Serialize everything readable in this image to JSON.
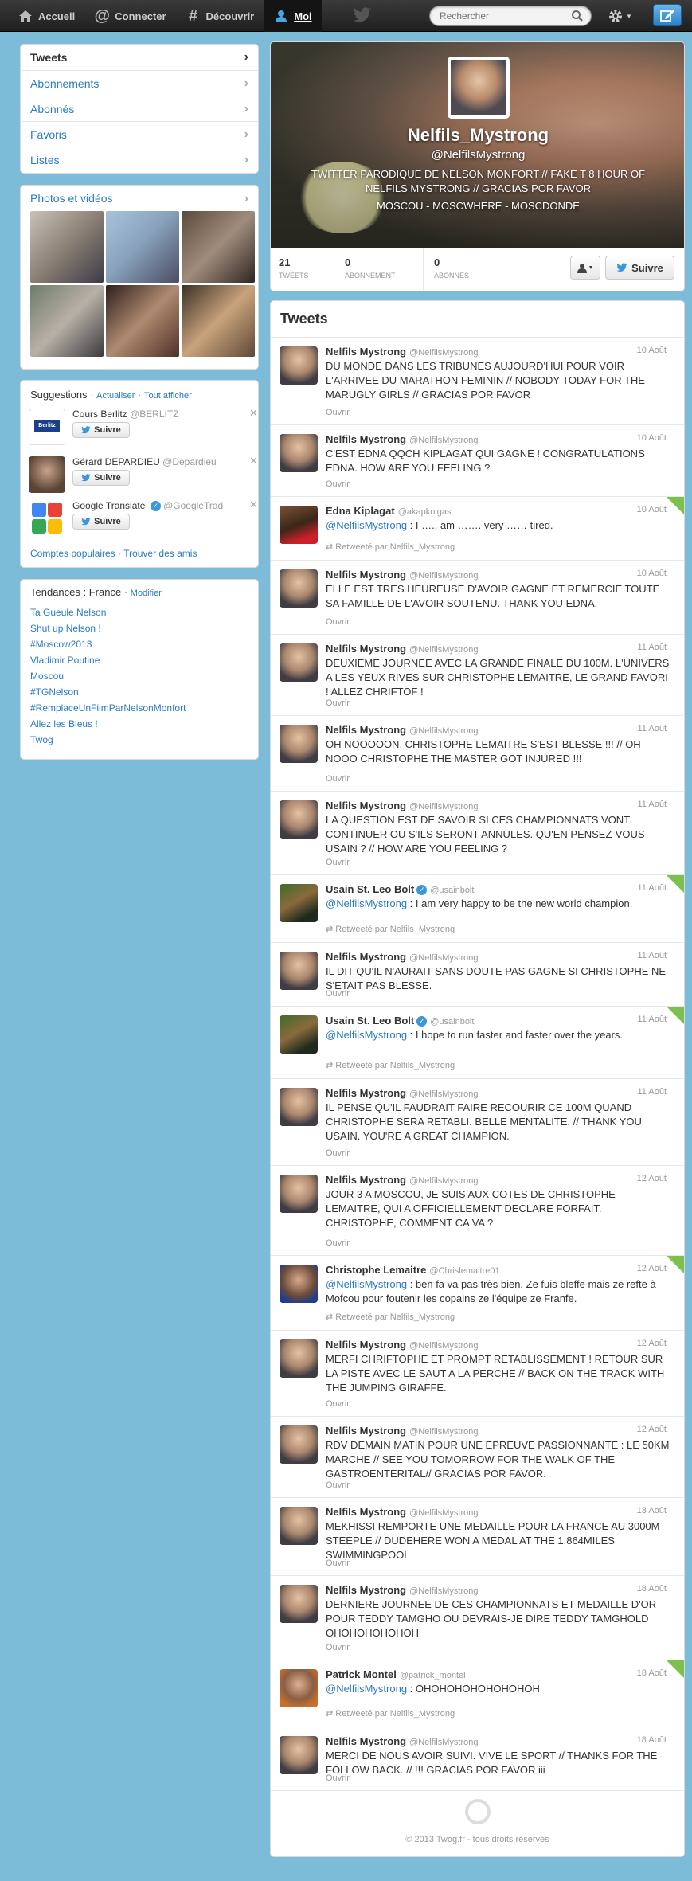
{
  "nav": {
    "items": [
      {
        "label": "Accueil",
        "icon": "home-icon"
      },
      {
        "label": "Connecter",
        "icon": "at-icon"
      },
      {
        "label": "Découvrir",
        "icon": "hash-icon"
      },
      {
        "label": "Moi",
        "icon": "person-icon"
      }
    ]
  },
  "search": {
    "placeholder": "Rechercher"
  },
  "sidebar": {
    "menu": [
      "Tweets",
      "Abonnements",
      "Abonnés",
      "Favoris",
      "Listes"
    ],
    "photos_title": "Photos et vidéos",
    "suggestions": {
      "title": "Suggestions",
      "refresh": "Actualiser",
      "show_all": "Tout afficher",
      "items": [
        {
          "name": "Cours Berlitz",
          "handle": "@BERLITZ",
          "button": "Suivre"
        },
        {
          "name": "Gérard DEPARDIEU",
          "handle": "@Depardieu",
          "button": "Suivre"
        },
        {
          "name": "Google Translate",
          "handle": "@GoogleTrad",
          "button": "Suivre"
        }
      ],
      "popular": "Comptes populaires",
      "find_friends": "Trouver des amis",
      "separator": "·"
    },
    "trends": {
      "title": "Tendances : France",
      "modify": "Modifier",
      "items": [
        "Ta Gueule Nelson",
        "Shut up Nelson !",
        "#Moscow2013",
        "Vladimir Poutine",
        "Moscou",
        "#TGNelson",
        "#RemplaceUnFilmParNelsonMonfort",
        "Allez les Bleus !",
        "Twog"
      ]
    }
  },
  "profile": {
    "name": "Nelfils_Mystrong",
    "handle": "@NelfilsMystrong",
    "bio": "TWITTER PARODIQUE DE NELSON MONFORT // FAKE T 8 HOUR OF NELFILS MYSTRONG // GRACIAS POR FAVOR",
    "location": "MOSCOU - MOSCWHERE - MOSCDONDE",
    "stats": [
      {
        "value": "21",
        "label": "TWEETS"
      },
      {
        "value": "0",
        "label": "ABONNEMENT"
      },
      {
        "value": "0",
        "label": "ABONNÉS"
      }
    ],
    "follow_button": "Suivre"
  },
  "timeline": {
    "title": "Tweets",
    "open_label": "Ouvrir",
    "tweets": [
      {
        "name": "Nelfils Mystrong",
        "handle": "@NelfilsMystrong",
        "date": "10 Août",
        "mention": "",
        "text": "DU MONDE DANS LES TRIBUNES AUJOURD'HUI POUR VOIR L'ARRIVEE DU MARATHON FEMININ // NOBODY TODAY FOR THE MARUGLY GIRLS // GRACIAS POR FAVOR",
        "retweet": ""
      },
      {
        "name": "Nelfils Mystrong",
        "handle": "@NelfilsMystrong",
        "date": "10 Août",
        "mention": "",
        "text": "C'EST EDNA QQCH KIPLAGAT QUI GAGNE ! CONGRATULATIONS EDNA. HOW ARE YOU FEELING ?",
        "retweet": ""
      },
      {
        "name": "Edna Kiplagat",
        "handle": "@akapkoigas",
        "date": "10 Août",
        "mention": "@NelfilsMystrong",
        "text": " : I ….. am ……. very …… tired.",
        "retweet": "Retweeté par Nelfils_Mystrong"
      },
      {
        "name": "Nelfils Mystrong",
        "handle": "@NelfilsMystrong",
        "date": "10 Août",
        "mention": "",
        "text": "ELLE EST TRES HEUREUSE D'AVOIR GAGNE ET REMERCIE TOUTE SA FAMILLE DE L'AVOIR SOUTENU. THANK YOU EDNA.",
        "retweet": ""
      },
      {
        "name": "Nelfils Mystrong",
        "handle": "@NelfilsMystrong",
        "date": "11 Août",
        "mention": "",
        "text": "DEUXIEME JOURNEE AVEC LA GRANDE FINALE DU 100M. L'UNIVERS A LES YEUX RIVES SUR CHRISTOPHE LEMAITRE, LE GRAND FAVORI ! ALLEZ CHRIFTOF !",
        "retweet": ""
      },
      {
        "name": "Nelfils Mystrong",
        "handle": "@NelfilsMystrong",
        "date": "11 Août",
        "mention": "",
        "text": "OH NOOOOON, CHRISTOPHE LEMAITRE S'EST BLESSE !!! // OH NOOO CHRISTOPHE THE MASTER GOT INJURED !!!",
        "retweet": ""
      },
      {
        "name": "Nelfils Mystrong",
        "handle": "@NelfilsMystrong",
        "date": "11 Août",
        "mention": "",
        "text": "LA QUESTION EST DE SAVOIR SI CES CHAMPIONNATS VONT CONTINUER OU S'ILS SERONT ANNULES. QU'EN PENSEZ-VOUS USAIN ? // HOW ARE YOU FEELING ?",
        "retweet": ""
      },
      {
        "name": "Usain St. Leo Bolt",
        "handle": "@usainbolt",
        "date": "11 Août",
        "mention": "@NelfilsMystrong",
        "text": " : I am very happy to be the new world champion.",
        "retweet": "Retweeté par Nelfils_Mystrong"
      },
      {
        "name": "Nelfils Mystrong",
        "handle": "@NelfilsMystrong",
        "date": "11 Août",
        "mention": "",
        "text": "IL DIT QU'IL N'AURAIT SANS DOUTE PAS GAGNE SI CHRISTOPHE NE S'ETAIT PAS BLESSE.",
        "retweet": ""
      },
      {
        "name": "Usain St. Leo Bolt",
        "handle": "@usainbolt",
        "date": "11 Août",
        "mention": "@NelfilsMystrong",
        "text": " : I hope to run faster and faster over the years.",
        "retweet": "Retweeté par Nelfils_Mystrong"
      },
      {
        "name": "Nelfils Mystrong",
        "handle": "@NelfilsMystrong",
        "date": "11 Août",
        "mention": "",
        "text": "IL PENSE QU'IL FAUDRAIT FAIRE RECOURIR CE 100M QUAND CHRISTOPHE SERA RETABLI. BELLE MENTALITE. // THANK YOU USAIN. YOU'RE A GREAT CHAMPION.",
        "retweet": ""
      },
      {
        "name": "Nelfils Mystrong",
        "handle": "@NelfilsMystrong",
        "date": "12 Août",
        "mention": "",
        "text": "JOUR 3 A MOSCOU, JE SUIS AUX COTES DE CHRISTOPHE LEMAITRE, QUI A OFFICIELLEMENT DECLARE FORFAIT. CHRISTOPHE, COMMENT CA VA ?",
        "retweet": ""
      },
      {
        "name": "Christophe Lemaitre",
        "handle": "@Chrislemaitre01",
        "date": "12 Août",
        "mention": "@NelfilsMystrong",
        "text": " : ben fa va pas très bien. Ze fuis bleffe mais ze refte à Mofcou pour foutenir les copains ze l'équipe ze Franfe.",
        "retweet": "Retweeté par Nelfils_Mystrong"
      },
      {
        "name": "Nelfils Mystrong",
        "handle": "@NelfilsMystrong",
        "date": "12 Août",
        "mention": "",
        "text": "MERFI CHRIFTOPHE ET PROMPT RETABLISSEMENT ! RETOUR SUR LA PISTE AVEC LE SAUT A LA PERCHE // BACK ON THE TRACK WITH THE JUMPING GIRAFFE.",
        "retweet": ""
      },
      {
        "name": "Nelfils Mystrong",
        "handle": "@NelfilsMystrong",
        "date": "12 Août",
        "mention": "",
        "text": "RDV DEMAIN MATIN POUR UNE EPREUVE PASSIONNANTE : LE 50KM MARCHE // SEE YOU TOMORROW FOR THE WALK OF THE GASTROENTERITAL// GRACIAS POR FAVOR.",
        "retweet": ""
      },
      {
        "name": "Nelfils Mystrong",
        "handle": "@NelfilsMystrong",
        "date": "13 Août",
        "mention": "",
        "text": "MEKHISSI REMPORTE UNE MEDAILLE POUR LA FRANCE AU 3000M STEEPLE // DUDEHERE WON A MEDAL AT THE 1.864MILES SWIMMINGPOOL",
        "retweet": ""
      },
      {
        "name": "Nelfils Mystrong",
        "handle": "@NelfilsMystrong",
        "date": "18 Août",
        "mention": "",
        "text": "DERNIERE JOURNEE DE CES CHAMPIONNATS ET MEDAILLE D'OR POUR TEDDY TAMGHO OU DEVRAIS-JE DIRE TEDDY TAMGHOLD OHOHOHOHOHOH",
        "retweet": ""
      },
      {
        "name": "Patrick Montel",
        "handle": "@patrick_montel",
        "date": "18 Août",
        "mention": "@NelfilsMystrong",
        "text": " : OHOHOHOHOHOHOHOH",
        "retweet": "Retweeté par Nelfils_Mystrong"
      },
      {
        "name": "Nelfils Mystrong",
        "handle": "@NelfilsMystrong",
        "date": "18 Août",
        "mention": "",
        "text": "MERCI DE NOUS AVOIR SUIVI. VIVE LE SPORT // THANKS FOR THE FOLLOW BACK. // !!! GRACIAS POR FAVOR iii",
        "retweet": ""
      }
    ]
  },
  "footer": {
    "copyright": "© 2013 Twog.fr - tous droits réservés"
  },
  "colors": {
    "accent": "#2a7bbf",
    "background": "#7dbcd9",
    "retweet_corner": "#7cc04d"
  }
}
